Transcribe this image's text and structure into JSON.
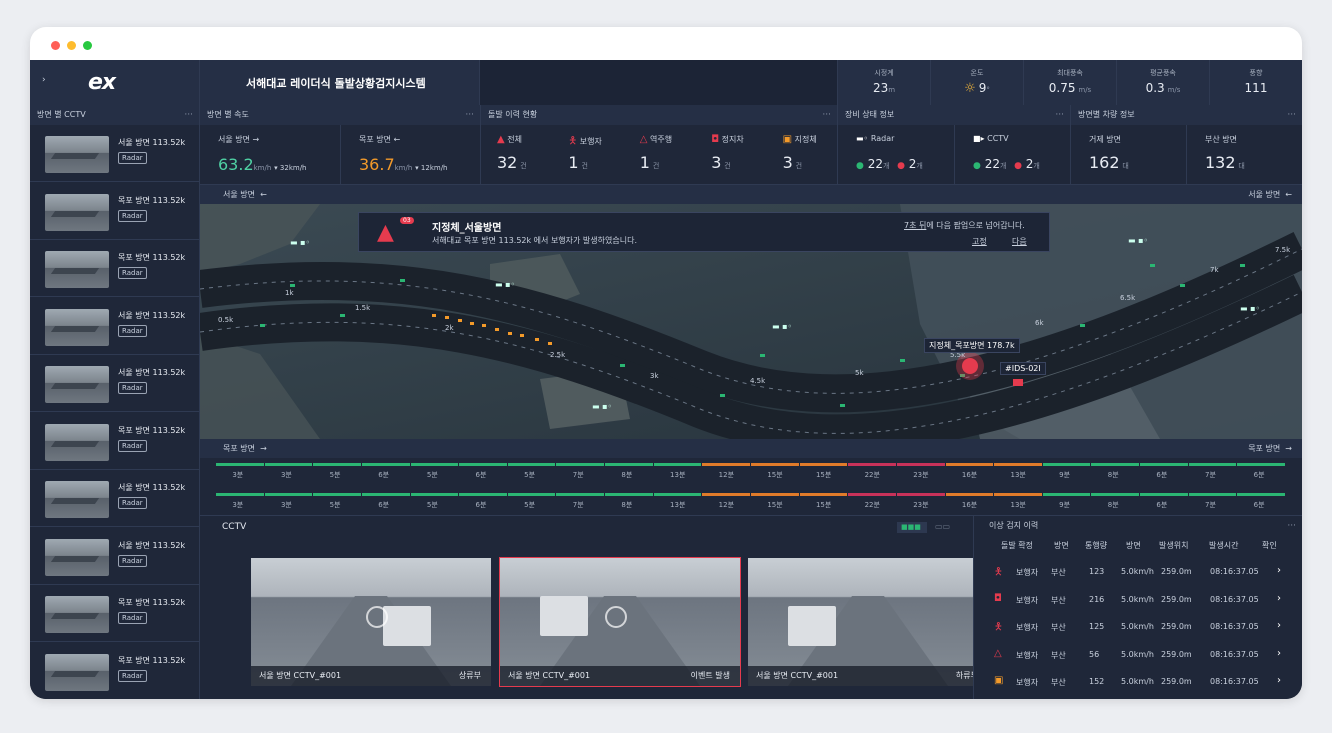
{
  "window": {
    "dots": [
      "#ff5f57",
      "#febc2e",
      "#28c840"
    ]
  },
  "brand": {
    "logo": "ex",
    "title": "서해대교 레이더식 돌발상황검지시스템"
  },
  "weather": [
    {
      "label": "시정계",
      "value": "23",
      "unit": "m"
    },
    {
      "label": "온도",
      "value": "9",
      "unit": "°",
      "icon": "sun-icon"
    },
    {
      "label": "최대풍속",
      "value": "0.75",
      "unit": "m/s"
    },
    {
      "label": "평균풍속",
      "value": "0.3",
      "unit": "m/s"
    },
    {
      "label": "풍향",
      "value": "111",
      "unit": ""
    }
  ],
  "sections": {
    "cctv_by_dir": "방면 별 CCTV",
    "speed_by_dir": "방면 별 속도",
    "incident_status": "돌발 이력 현황",
    "equip_status": "장비 상태 정보",
    "vehicle_info": "방면별 차량 정보",
    "cctv": "CCTV",
    "anomaly": "이상 검지 이력",
    "more": "···"
  },
  "speed": [
    {
      "dir": "서울 방면",
      "arrow": "→",
      "value": "63.2",
      "unit": "km/h",
      "delta": "▾ 32km/h",
      "color": "#4fd1a4"
    },
    {
      "dir": "목포 방면",
      "arrow": "←",
      "value": "36.7",
      "unit": "km/h",
      "delta": "▾ 12km/h",
      "color": "#f39a2a"
    }
  ],
  "incidents": [
    {
      "label": "전체",
      "value": "32",
      "unit": "건",
      "icon": "warning-icon",
      "color": "#e53b4e"
    },
    {
      "label": "보행자",
      "value": "1",
      "unit": "건",
      "icon": "pedestrian-icon",
      "color": "#e53b4e"
    },
    {
      "label": "역주행",
      "value": "1",
      "unit": "건",
      "icon": "warning-outline-icon",
      "color": "#e53b4e"
    },
    {
      "label": "정지차",
      "value": "3",
      "unit": "건",
      "icon": "car-icon",
      "color": "#e53b4e"
    },
    {
      "label": "지정체",
      "value": "3",
      "unit": "건",
      "icon": "congestion-icon",
      "color": "#f39a2a"
    }
  ],
  "equipment": [
    {
      "label": "Radar",
      "ok": "22",
      "ok_unit": "개",
      "bad": "2",
      "bad_unit": "개",
      "icon": "radar-icon"
    },
    {
      "label": "CCTV",
      "ok": "22",
      "ok_unit": "개",
      "bad": "2",
      "bad_unit": "개",
      "icon": "camera-icon"
    }
  ],
  "vehicles": [
    {
      "dir": "거제 방면",
      "value": "162",
      "unit": "대"
    },
    {
      "dir": "부산 방면",
      "value": "132",
      "unit": "대"
    }
  ],
  "sidebar": [
    {
      "label": "서울 방면 113.52k",
      "tag": "Radar"
    },
    {
      "label": "목포 방면 113.52k",
      "tag": "Radar"
    },
    {
      "label": "목포 방면 113.52k",
      "tag": "Radar"
    },
    {
      "label": "서울 방면 113.52k",
      "tag": "Radar"
    },
    {
      "label": "서울 방면 113.52k",
      "tag": "Radar"
    },
    {
      "label": "목포 방면 113.52k",
      "tag": "Radar"
    },
    {
      "label": "서울 방면 113.52k",
      "tag": "Radar"
    },
    {
      "label": "서울 방면 113.52k",
      "tag": "Radar"
    },
    {
      "label": "목포 방면 113.52k",
      "tag": "Radar"
    },
    {
      "label": "목포 방면 113.52k",
      "tag": "Radar"
    }
  ],
  "map": {
    "top_dir": "서울 방면",
    "top_arrow": "←",
    "bottom_dir": "목포 방면",
    "bottom_arrow": "→",
    "alert": {
      "badge": "03",
      "title": "지정체_서울방면",
      "desc": "서해대교 목포 방면 113.52k 에서 보행자가 발생하였습니다.",
      "notice_link": "7초 뒤",
      "notice_rest": "에 다음 팝업으로 넘어갑니다.",
      "fix": "고정",
      "next": "다음"
    },
    "marker_label": "지정체_목포방면 178.7k",
    "device": "#IDS-02I",
    "km": [
      "0.5k",
      "1k",
      "1.5k",
      "2k",
      "2.5k",
      "3k",
      "4.5k",
      "5k",
      "5.5k",
      "6k",
      "6.5k",
      "7k",
      "7.5k"
    ]
  },
  "timeline": {
    "labels": [
      "3분",
      "3분",
      "5분",
      "6분",
      "5분",
      "6분",
      "5분",
      "7분",
      "8분",
      "13분",
      "12분",
      "15분",
      "15분",
      "22분",
      "23분",
      "16분",
      "13분",
      "9분",
      "8분",
      "6분",
      "7분",
      "6분"
    ],
    "colors": [
      "#2bb673",
      "#2bb673",
      "#2bb673",
      "#2bb673",
      "#2bb673",
      "#2bb673",
      "#2bb673",
      "#2bb673",
      "#2bb673",
      "#2bb673",
      "#e07b2a",
      "#e07b2a",
      "#e07b2a",
      "#c8325a",
      "#c8325a",
      "#e07b2a",
      "#e07b2a",
      "#2bb673",
      "#2bb673",
      "#2bb673",
      "#2bb673",
      "#2bb673"
    ]
  },
  "cameras": [
    {
      "dir": "서울 방면",
      "id": "CCTV_#001",
      "status": "상류부"
    },
    {
      "dir": "서울 방면",
      "id": "CCTV_#001",
      "status": "이벤트 발생"
    },
    {
      "dir": "서울 방면",
      "id": "CCTV_#001",
      "status": "하류부"
    }
  ],
  "anomaly_headers": [
    "돌발 확정",
    "방면",
    "통행량",
    "방면",
    "발생위치",
    "발생시간",
    "확인"
  ],
  "anomaly_rows": [
    {
      "icon": "pedestrian-icon",
      "type": "보행자",
      "dir": "부산",
      "count": "123",
      "speed": "5.0km/h",
      "pos": "259.0m",
      "time": "08:16:37.05"
    },
    {
      "icon": "car-icon",
      "type": "보행자",
      "dir": "부산",
      "count": "216",
      "speed": "5.0km/h",
      "pos": "259.0m",
      "time": "08:16:37.05"
    },
    {
      "icon": "pedestrian-icon",
      "type": "보행자",
      "dir": "부산",
      "count": "125",
      "speed": "5.0km/h",
      "pos": "259.0m",
      "time": "08:16:37.05"
    },
    {
      "icon": "warning-outline-icon",
      "type": "보행자",
      "dir": "부산",
      "count": "56",
      "speed": "5.0km/h",
      "pos": "259.0m",
      "time": "08:16:37.05"
    },
    {
      "icon": "congestion-icon",
      "type": "보행자",
      "dir": "부산",
      "count": "152",
      "speed": "5.0km/h",
      "pos": "259.0m",
      "time": "08:16:37.05"
    }
  ]
}
